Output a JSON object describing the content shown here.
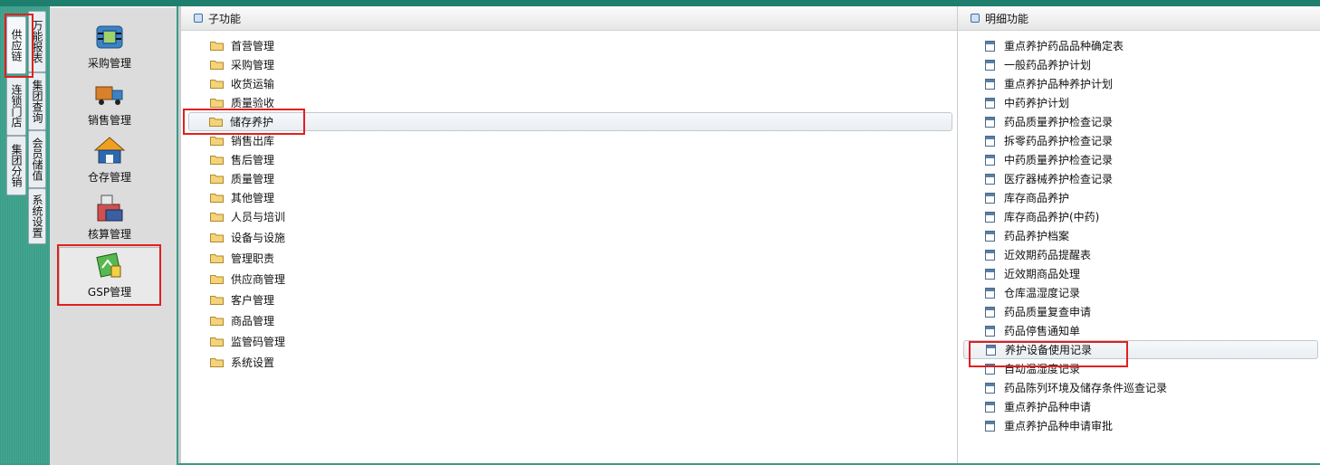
{
  "vertical_tabs_outer": [
    {
      "label": "供应链"
    },
    {
      "label": "连锁门店"
    },
    {
      "label": "集团分销"
    }
  ],
  "vertical_tabs_inner": [
    {
      "label": "万能报表"
    },
    {
      "label": "集团查询"
    },
    {
      "label": "会员储值"
    },
    {
      "label": "系统设置"
    }
  ],
  "nav_items": [
    {
      "label": "采购管理",
      "icon": "purchase-icon"
    },
    {
      "label": "销售管理",
      "icon": "truck-icon"
    },
    {
      "label": "仓存管理",
      "icon": "warehouse-icon"
    },
    {
      "label": "核算管理",
      "icon": "accounting-icon"
    },
    {
      "label": "GSP管理",
      "icon": "gsp-icon"
    }
  ],
  "sub_panel": {
    "title": "子功能",
    "items": [
      {
        "label": "首营管理"
      },
      {
        "label": "采购管理"
      },
      {
        "label": "收货运输"
      },
      {
        "label": "质量验收"
      },
      {
        "label": "储存养护"
      },
      {
        "label": "销售出库"
      },
      {
        "label": "售后管理"
      },
      {
        "label": "质量管理"
      },
      {
        "label": "其他管理"
      },
      {
        "label": "人员与培训"
      },
      {
        "label": "设备与设施"
      },
      {
        "label": "管理职责"
      },
      {
        "label": "供应商管理"
      },
      {
        "label": "客户管理"
      },
      {
        "label": "商品管理"
      },
      {
        "label": "监管码管理"
      },
      {
        "label": "系统设置"
      }
    ]
  },
  "detail_panel": {
    "title": "明细功能",
    "items": [
      {
        "label": "重点养护药品品种确定表"
      },
      {
        "label": "一般药品养护计划"
      },
      {
        "label": "重点养护品种养护计划"
      },
      {
        "label": "中药养护计划"
      },
      {
        "label": "药品质量养护检查记录"
      },
      {
        "label": "拆零药品养护检查记录"
      },
      {
        "label": "中药质量养护检查记录"
      },
      {
        "label": "医疗器械养护检查记录"
      },
      {
        "label": "库存商品养护"
      },
      {
        "label": "库存商品养护(中药)"
      },
      {
        "label": "药品养护档案"
      },
      {
        "label": "近效期药品提醒表"
      },
      {
        "label": "近效期商品处理"
      },
      {
        "label": "仓库温湿度记录"
      },
      {
        "label": "药品质量复查申请"
      },
      {
        "label": "药品停售通知单"
      },
      {
        "label": "养护设备使用记录"
      },
      {
        "label": "自动温湿度记录"
      },
      {
        "label": "药品陈列环境及储存条件巡查记录"
      },
      {
        "label": "重点养护品种申请"
      },
      {
        "label": "重点养护品种申请审批"
      }
    ]
  },
  "colors": {
    "highlight_box": "#e02020",
    "app_green": "#3d9a86"
  }
}
